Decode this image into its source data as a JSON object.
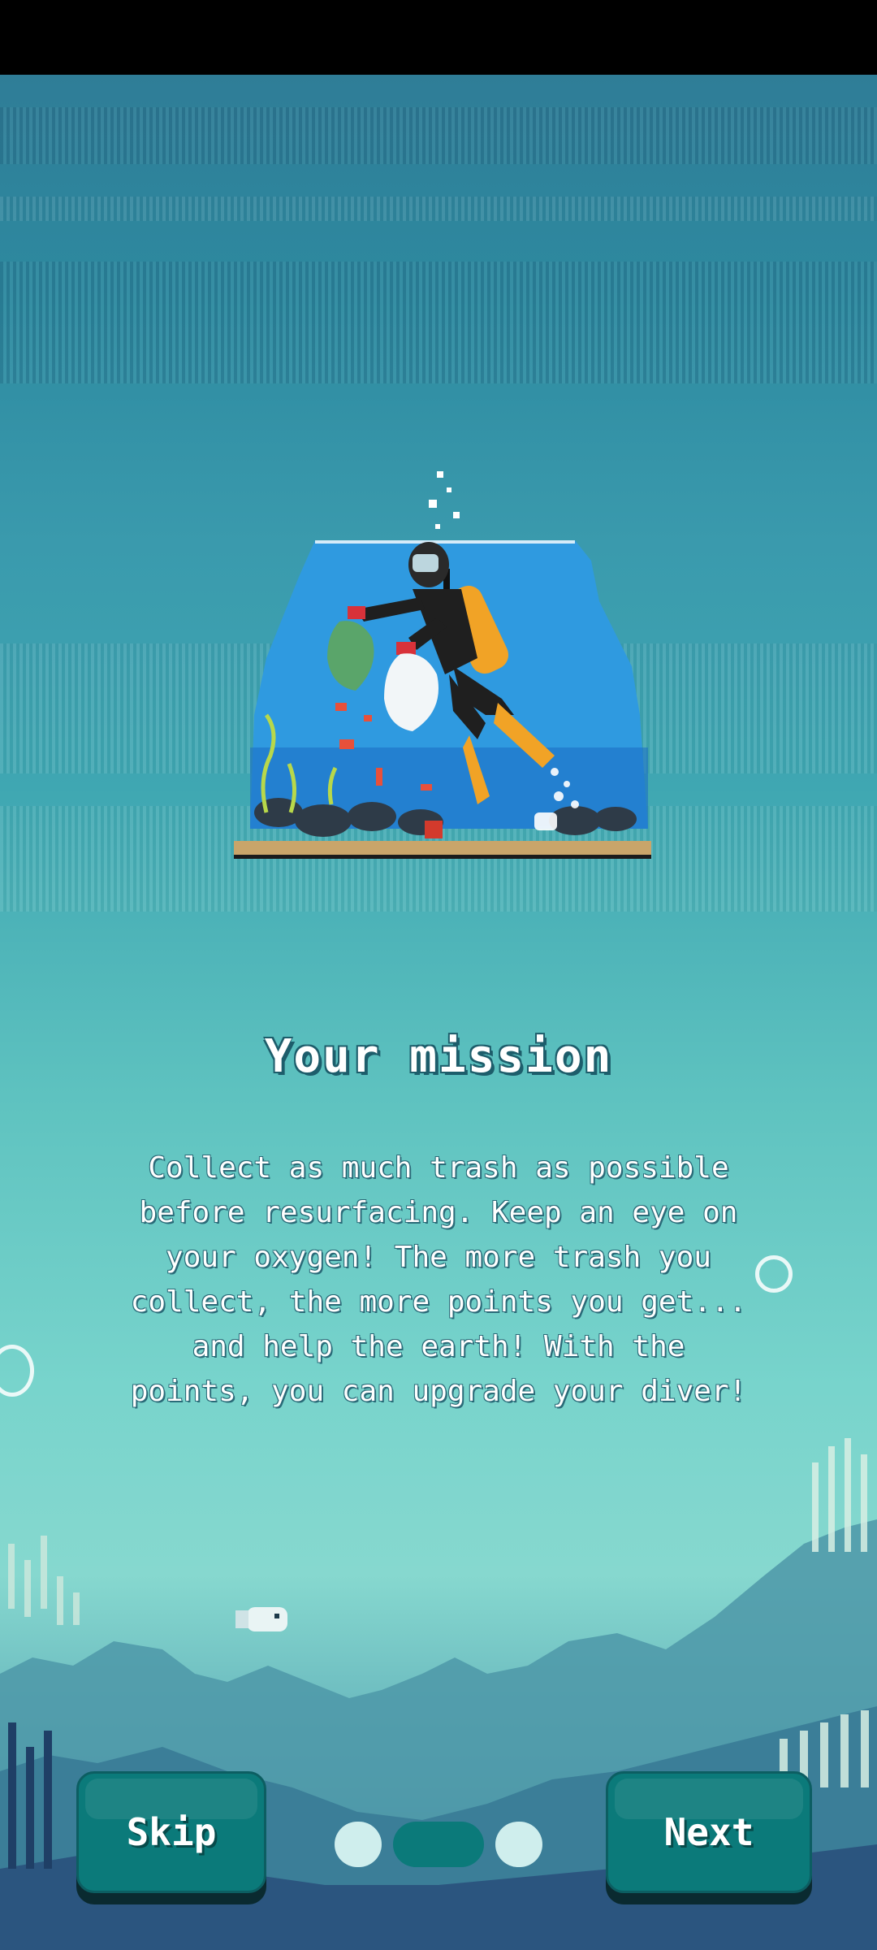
{
  "onboarding": {
    "title": "Your mission",
    "description": "Collect as much trash as possible before resurfacing. Keep an eye on your oxygen! The more trash you collect, the more points you get... and help the earth! With the points, you can upgrade your diver!",
    "skip_label": "Skip",
    "next_label": "Next",
    "pages_total": 3,
    "current_page": 2
  },
  "colors": {
    "button": "#0b7a7a",
    "button_shadow": "#0a2a30",
    "dot_active": "#0b7a7a",
    "dot_inactive": "#cfeeed"
  }
}
